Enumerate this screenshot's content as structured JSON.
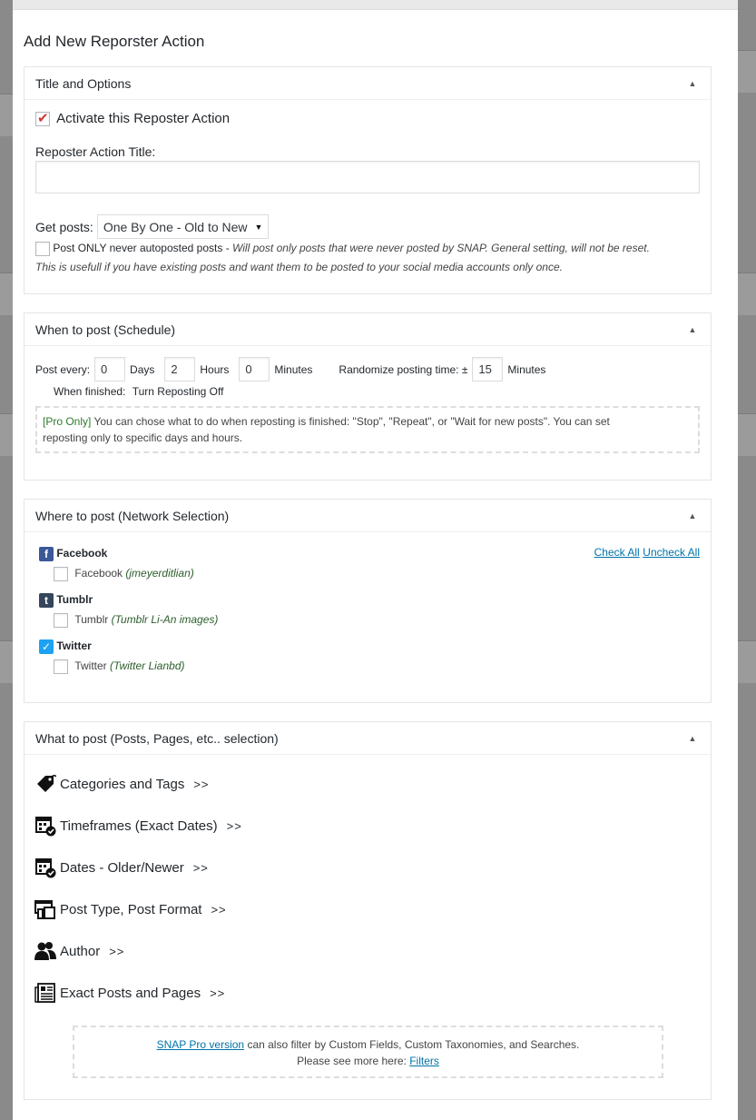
{
  "page_title": "Add New Reporster Action",
  "panels": {
    "title_options": {
      "header": "Title and Options",
      "activate_label": "Activate this Reposter Action",
      "activate_checked": true,
      "title_label": "Reposter Action Title:",
      "title_value": "",
      "get_posts_label": "Get posts:",
      "get_posts_value": "One By One - Old to New",
      "never_autoposted_label": "Post ONLY never autoposted posts",
      "never_autoposted_dash": " - ",
      "never_autoposted_note_line1": "Will post only posts that were never posted by SNAP. General setting, will not be reset.",
      "never_autoposted_note_line2": "This is usefull if you have existing posts and want them to be posted to your social media accounts only once."
    },
    "schedule": {
      "header": "When to post (Schedule)",
      "post_every_label": "Post every:",
      "days_value": "0",
      "days_label": "Days",
      "hours_value": "2",
      "hours_label": "Hours",
      "minutes_value": "0",
      "minutes_label": "Minutes",
      "randomize_label": "Randomize posting time: ±",
      "randomize_value": "15",
      "randomize_unit": "Minutes",
      "when_finished_label": "When finished:",
      "when_finished_value": "Turn Reposting Off",
      "pro_tag": "[Pro Only]",
      "pro_note_line1": "You can chose what to do when reposting is finished: \"Stop\", \"Repeat\", or \"Wait for new posts\". You can set",
      "pro_note_line2": "reposting only to specific days and hours."
    },
    "networks": {
      "header": "Where to post (Network Selection)",
      "check_all": "Check All",
      "uncheck_all": "Uncheck All",
      "items": [
        {
          "network": "Facebook",
          "icon": "facebook-icon",
          "account_prefix": "Facebook",
          "account_name": "(jmeyerditlian)"
        },
        {
          "network": "Tumblr",
          "icon": "tumblr-icon",
          "account_prefix": "Tumblr",
          "account_name": "(Tumblr Li-An images)"
        },
        {
          "network": "Twitter",
          "icon": "twitter-icon",
          "account_prefix": "Twitter",
          "account_name": "(Twitter Lianbd)"
        }
      ]
    },
    "what_to_post": {
      "header": "What to post (Posts, Pages, etc.. selection)",
      "arrows": ">>",
      "filters": [
        {
          "label": "Categories and Tags",
          "icon": "tag-icon"
        },
        {
          "label": "Timeframes (Exact Dates)",
          "icon": "calendar-check-icon"
        },
        {
          "label": "Dates - Older/Newer",
          "icon": "calendar-check-icon"
        },
        {
          "label": "Post Type, Post Format",
          "icon": "post-type-icon"
        },
        {
          "label": "Author",
          "icon": "users-icon"
        },
        {
          "label": "Exact Posts and Pages",
          "icon": "newspaper-icon"
        }
      ],
      "pro_link": "SNAP Pro version",
      "pro_text": "can also filter by Custom Fields, Custom Taxonomies, and Searches.",
      "see_more": "Please see more here:",
      "filters_link": "Filters"
    }
  }
}
